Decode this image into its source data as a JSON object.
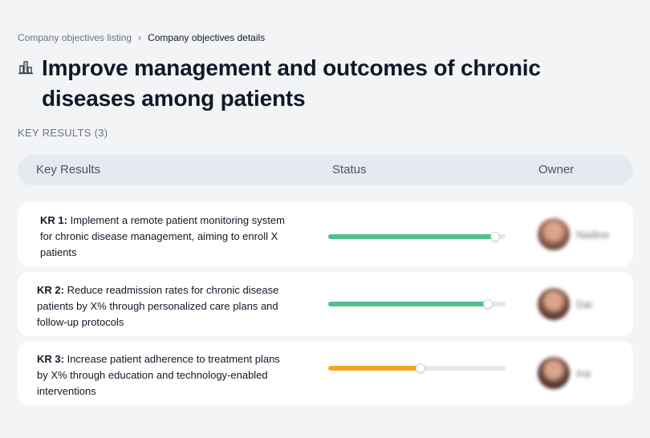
{
  "breadcrumb": {
    "parent": "Company objectives listing",
    "separator": "›",
    "current": "Company objectives details"
  },
  "objective": {
    "icon": "building-chart-icon",
    "title": "Improve management and outcomes of chronic diseases among patients"
  },
  "key_results_count_label": "KEY RESULTS (3)",
  "table": {
    "headers": {
      "key_results": "Key Results",
      "status": "Status",
      "owner": "Owner"
    },
    "rows": [
      {
        "kr_label": "KR 1:",
        "description": "Implement a remote patient monitoring system for chronic disease management, aiming to enroll X patients",
        "progress_percent": 94,
        "progress_color": "#52c08b",
        "owner_name": "Nadine",
        "avatar_color": "#8a5a4a"
      },
      {
        "kr_label": "KR 2:",
        "description": "Reduce readmission rates for chronic disease patients by X% through personalized care plans and follow-up protocols",
        "progress_percent": 90,
        "progress_color": "#52c08b",
        "owner_name": "Dai",
        "avatar_color": "#6b4438"
      },
      {
        "kr_label": "KR 3:",
        "description": "Increase patient adherence to treatment plans by X% through education and technology-enabled interventions",
        "progress_percent": 52,
        "progress_color": "#f5a623",
        "owner_name": "Ina",
        "avatar_color": "#5a3a32"
      }
    ]
  }
}
